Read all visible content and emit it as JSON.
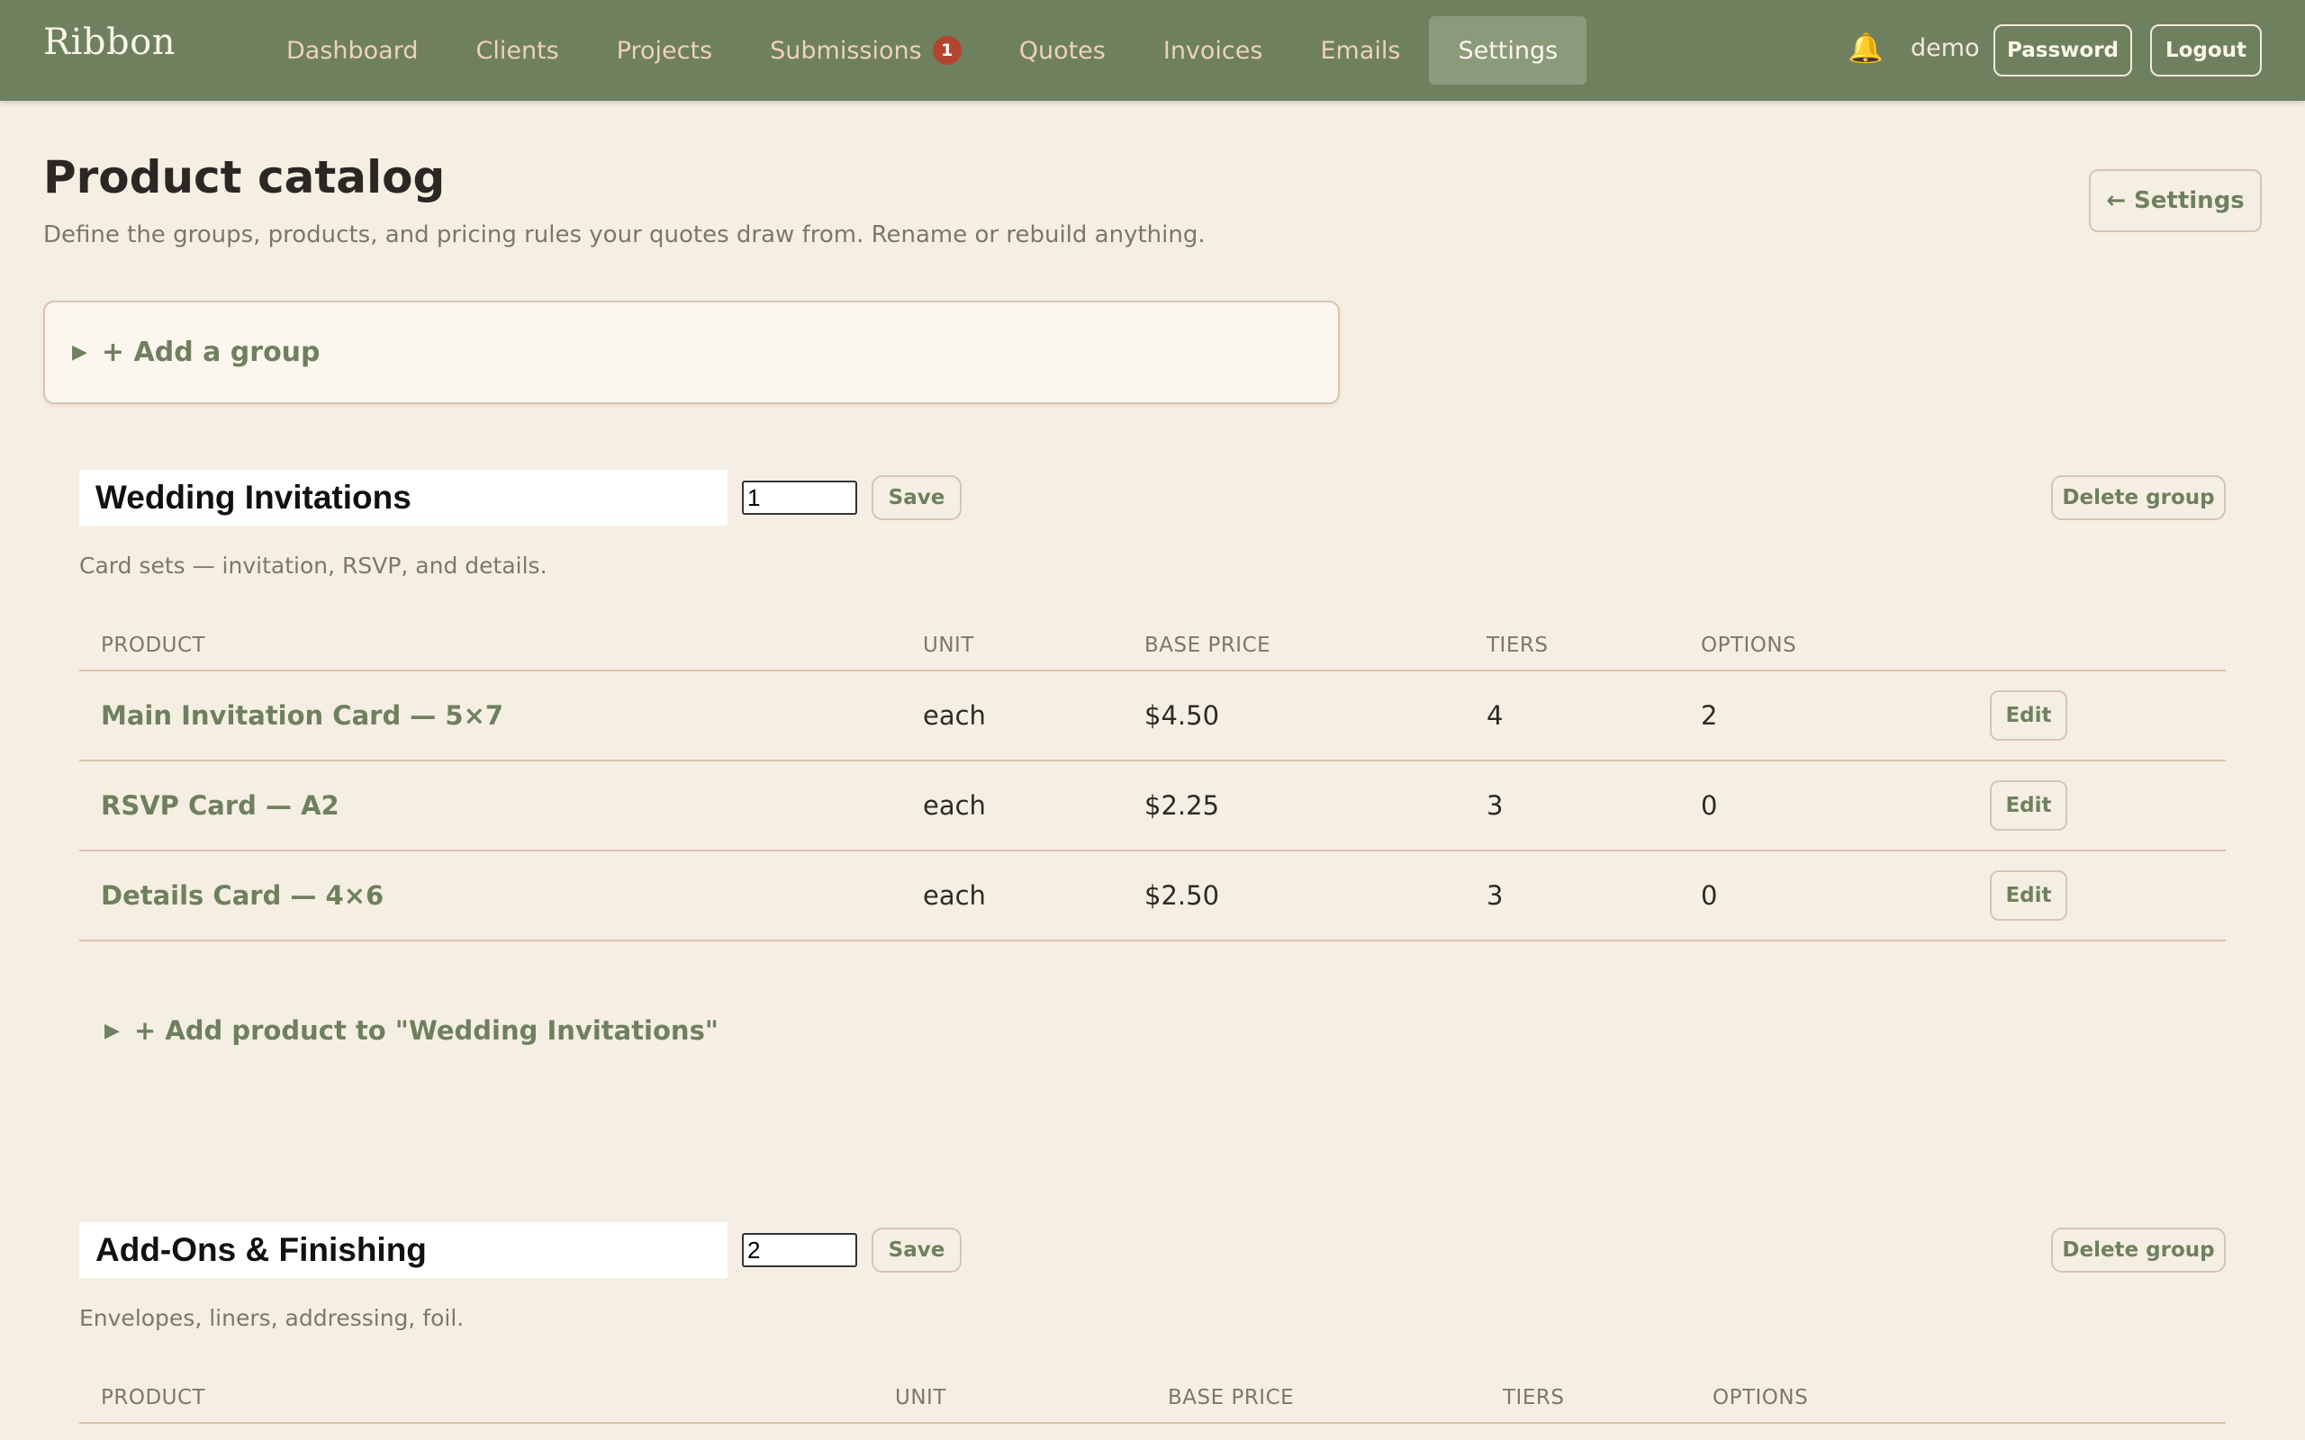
{
  "app": {
    "brand": "Ribbon"
  },
  "nav": {
    "items": [
      {
        "label": "Dashboard"
      },
      {
        "label": "Clients"
      },
      {
        "label": "Projects"
      },
      {
        "label": "Submissions",
        "badge": "1"
      },
      {
        "label": "Quotes"
      },
      {
        "label": "Invoices"
      },
      {
        "label": "Emails"
      },
      {
        "label": "Settings",
        "active": true
      }
    ],
    "bell_icon": "bell-icon",
    "user": "demo",
    "password_label": "Password",
    "logout_label": "Logout"
  },
  "header": {
    "title": "Product catalog",
    "subtitle": "Define the groups, products, and pricing rules your quotes draw from. Rename or rebuild anything.",
    "back_label": "← Settings"
  },
  "add_group": {
    "label": "+ Add a group"
  },
  "table_headers": {
    "product": "PRODUCT",
    "unit": "UNIT",
    "base_price": "BASE PRICE",
    "tiers": "TIERS",
    "options": "OPTIONS"
  },
  "groups": [
    {
      "name": "Wedding Invitations",
      "order": "1",
      "save_label": "Save",
      "delete_label": "Delete group",
      "description": "Card sets — invitation, RSVP, and details.",
      "products": [
        {
          "name": "Main Invitation Card — 5×7",
          "unit": "each",
          "base_price": "$4.50",
          "tiers": "4",
          "options": "2",
          "edit_label": "Edit"
        },
        {
          "name": "RSVP Card — A2",
          "unit": "each",
          "base_price": "$2.25",
          "tiers": "3",
          "options": "0",
          "edit_label": "Edit"
        },
        {
          "name": "Details Card — 4×6",
          "unit": "each",
          "base_price": "$2.50",
          "tiers": "3",
          "options": "0",
          "edit_label": "Edit"
        }
      ],
      "add_product_label": "+ Add product to \"Wedding Invitations\""
    },
    {
      "name": "Add-Ons & Finishing",
      "order": "2",
      "save_label": "Save",
      "delete_label": "Delete group",
      "description": "Envelopes, liners, addressing, foil."
    }
  ],
  "colors": {
    "nav_bg": "#6f805f",
    "page_bg": "#f5efe3",
    "accent": "#6f805f",
    "badge": "#b5442f"
  }
}
